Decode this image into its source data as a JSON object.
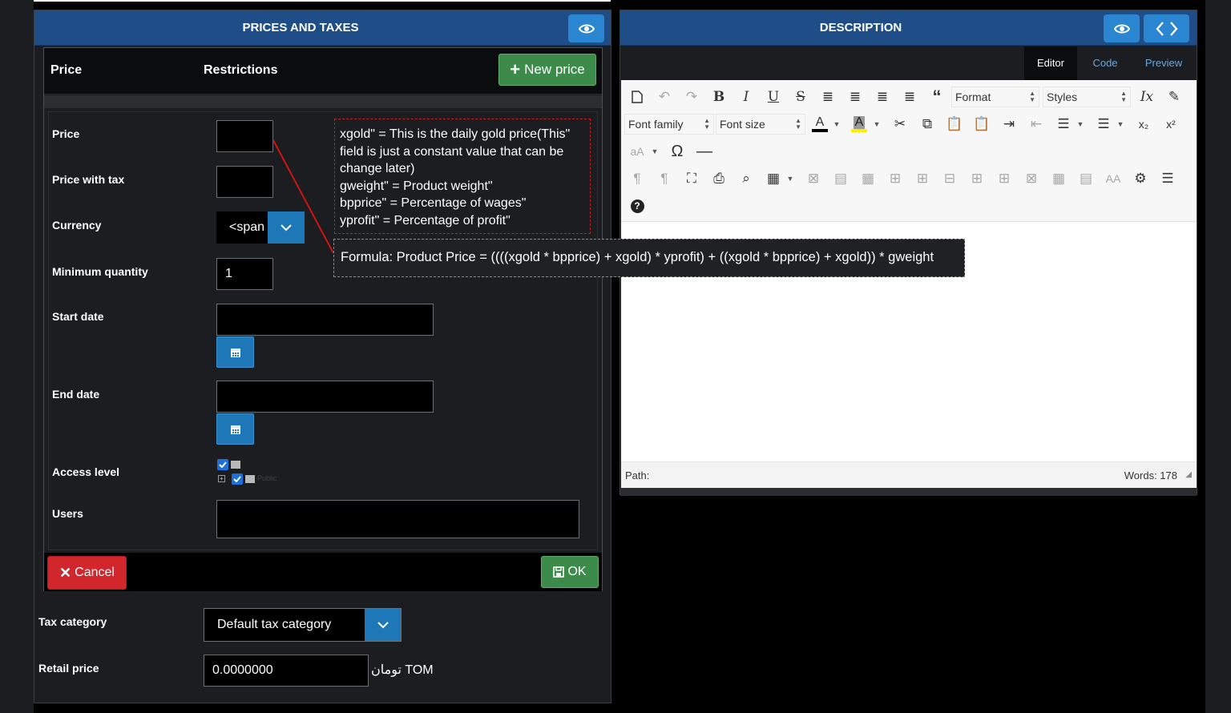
{
  "prices_panel": {
    "title": "PRICES AND TAXES",
    "tabs": [
      "Price",
      "Restrictions"
    ],
    "new_price_label": "New price",
    "fields": {
      "price_label": "Price",
      "price_with_tax_label": "Price with tax",
      "currency_label": "Currency",
      "currency_value": "<span",
      "min_qty_label": "Minimum quantity",
      "min_qty_value": "1",
      "start_date_label": "Start date",
      "end_date_label": "End date",
      "access_level_label": "Access level",
      "access_level_child": "Public",
      "users_label": "Users"
    },
    "cancel_label": "Cancel",
    "ok_label": "OK",
    "tax_category_label": "Tax category",
    "tax_category_value": "Default tax category",
    "retail_price_label": "Retail price",
    "retail_price_value": "0.0000000",
    "retail_currency": "تومان TOM"
  },
  "description_panel": {
    "title": "DESCRIPTION",
    "tabs": [
      "Editor",
      "Code",
      "Preview"
    ],
    "active_tab": "Editor",
    "toolbar": {
      "format": "Format",
      "styles": "Styles",
      "font_family": "Font family",
      "font_size": "Font size"
    },
    "status_path": "Path:",
    "word_count": "Words: 178"
  },
  "annotation": {
    "variables": [
      "xgold\" = This is the daily gold price(This\" field is just a constant value that can be change later)",
      "gweight\" = Product weight\"",
      "bpprice\" = Percentage of wages\"",
      "yprofit\" = Percentage of profit\""
    ],
    "formula": "Formula: Product Price = ((((xgold * bpprice) + xgold) * yprofit) + ((xgold * bpprice) + xgold)) * gweight"
  },
  "colors": {
    "header_blue": "#1f4d87",
    "button_blue": "#2a86d0",
    "green": "#3c8b4b",
    "red": "#d1262b",
    "annotation_red": "#c81e1e"
  }
}
